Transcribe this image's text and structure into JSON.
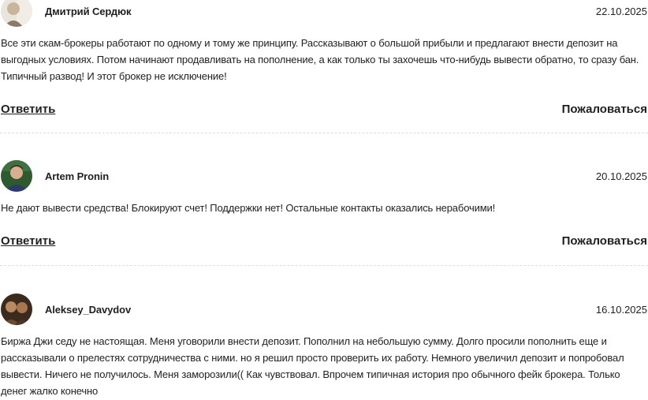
{
  "comments": [
    {
      "author": "Дмитрий Сердюк",
      "date": "22.10.2025",
      "text": "Все эти скам-брокеры работают по одному и тому же принципу. Рассказывают о большой прибыли и предлагают внести депозит на выгодных условиях. Потом начинают продавливать на пополнение, а как только ты захочешь что-нибудь вывести обратно, то сразу бан. Типичный развод! И этот брокер не исключение!",
      "reply_label": "Ответить",
      "report_label": "Пожаловаться"
    },
    {
      "author": "Artem Pronin",
      "date": "20.10.2025",
      "text": "Не дают вывести средства! Блокируют счет! Поддержки нет! Остальные контакты оказались нерабочими!",
      "reply_label": "Ответить",
      "report_label": "Пожаловаться"
    },
    {
      "author": "Aleksey_Davydov",
      "date": "16.10.2025",
      "text": "Биржа Джи седу не настоящая. Меня уговорили внести депозит. Пополнил на небольшую сумму. Долго просили пополнить еще и рассказывали о прелестях сотрудничества с ними. но я решил просто проверить их работу. Немного увеличил депозит и попробовал вывести. Ничего не получилось. Меня заморозили(( Как чувствовал. Впрочем типичная история про обычного фейк брокера. Только денег жалко конечно"
    }
  ]
}
